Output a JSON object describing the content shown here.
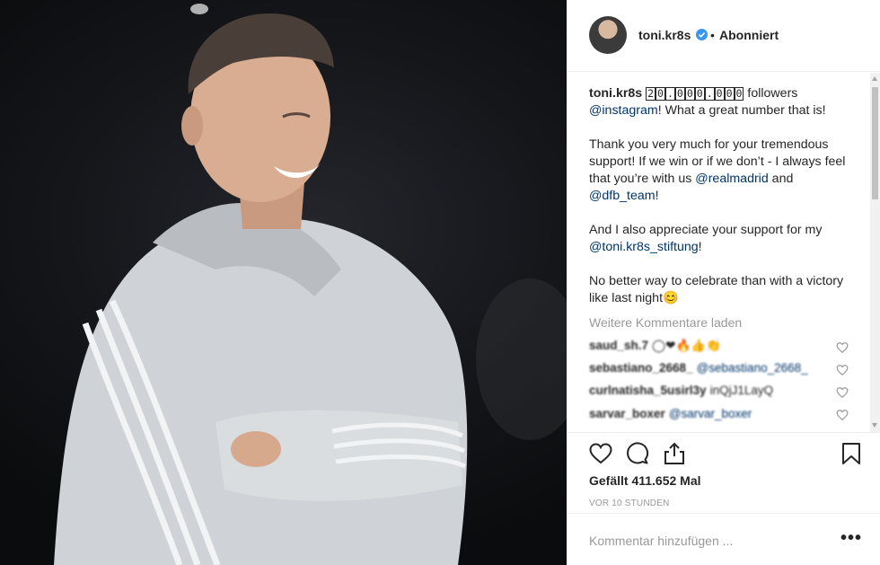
{
  "post": {
    "username": "toni.kr8s",
    "separator": "•",
    "follow_status": "Abonniert"
  },
  "caption": {
    "username": "toni.kr8s",
    "boxed_digits": [
      "2",
      "0",
      ".",
      "0",
      "0",
      "0",
      ".",
      "0",
      "0",
      "0"
    ],
    "line1_rest": " followers",
    "mention_instagram": "@instagram",
    "line1_end": "! What a great number that is!",
    "p2_start": "Thank you very much for your tremendous support! If we win or if we don’t - I always feel that you’re with us ",
    "mention_realmadrid": "@realmadrid",
    "p2_and": " and ",
    "mention_dfb": "@dfb_team",
    "p2_end": "!",
    "p3_start": "And I also appreciate your support for my ",
    "mention_stiftung": "@toni.kr8s_stiftung",
    "p3_end": "!",
    "p4": "No better way to celebrate than with a victory like last night",
    "p4_emoji": "😊"
  },
  "load_more": "Weitere Kommentare laden",
  "comments": [
    {
      "user": "saud_sh.7",
      "text": "◯❤🔥👍👏",
      "mention": ""
    },
    {
      "user": "sebastiano_2668_",
      "text": "",
      "mention": "@sebastiano_2668_"
    },
    {
      "user": "curlnatisha_5usirl3y",
      "text": "inQjJ1LayQ",
      "mention": ""
    },
    {
      "user": "sarvar_boxer",
      "text": "",
      "mention": "@sarvar_boxer"
    }
  ],
  "likes_text": "Gefällt 411.652 Mal",
  "timestamp": "VOR 10 STUNDEN",
  "add_comment_placeholder": "Kommentar hinzufügen ...",
  "more_label": "•••",
  "colors": {
    "verified": "#3897f0",
    "mention": "#003569",
    "muted": "#999999",
    "text": "#262626"
  },
  "icons": {
    "like": "heart-icon",
    "comment": "comment-icon",
    "share": "share-icon",
    "save": "bookmark-icon"
  }
}
